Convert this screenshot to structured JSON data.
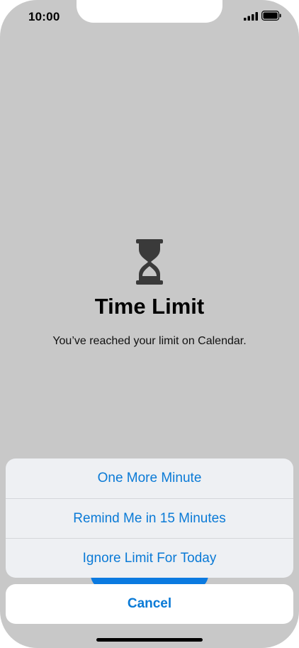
{
  "status_bar": {
    "time": "10:00",
    "icons": [
      "signal-icon",
      "battery-icon"
    ]
  },
  "screen": {
    "icon": "hourglass-icon",
    "title": "Time Limit",
    "message": "You’ve reached your limit on Calendar."
  },
  "action_sheet": {
    "items": [
      {
        "label": "One More Minute"
      },
      {
        "label": "Remind Me in 15 Minutes"
      },
      {
        "label": "Ignore Limit For Today"
      }
    ],
    "cancel_label": "Cancel"
  },
  "colors": {
    "background": "#c8c8c8",
    "accent": "#0a7ad6",
    "sheet_background": "#eef0f3",
    "cancel_background": "#ffffff"
  }
}
